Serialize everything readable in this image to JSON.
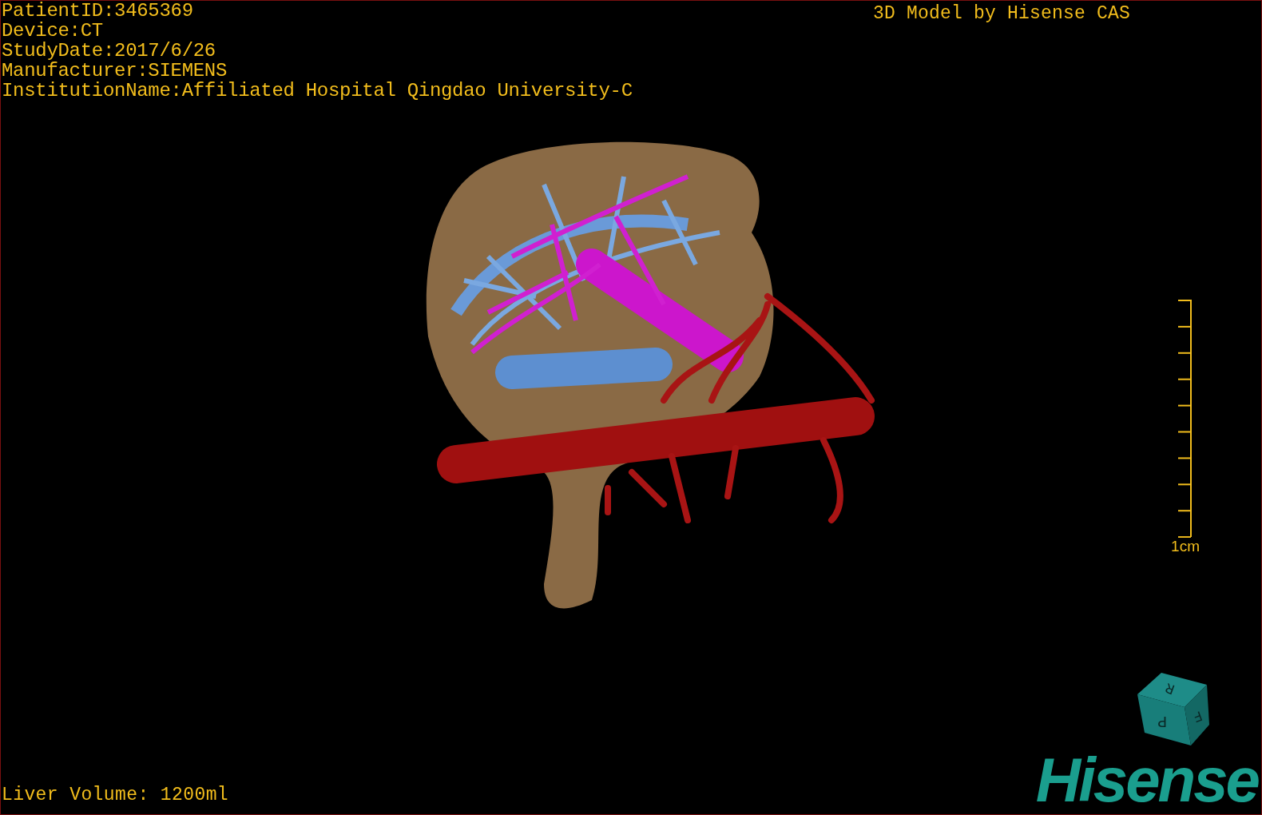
{
  "header": {
    "info_lines": [
      "PatientID:3465369",
      "Device:CT",
      "StudyDate:2017/6/26",
      "Manufacturer:SIEMENS",
      "InstitutionName:Affiliated Hospital Qingdao University-C"
    ],
    "credit": "3D Model by Hisense CAS"
  },
  "scale_bar": {
    "label": "1cm"
  },
  "orientation_cube": {
    "faces": [
      "R",
      "F",
      "P"
    ]
  },
  "footer": {
    "measurement": "Liver Volume: 1200ml",
    "logo": "Hisense"
  }
}
